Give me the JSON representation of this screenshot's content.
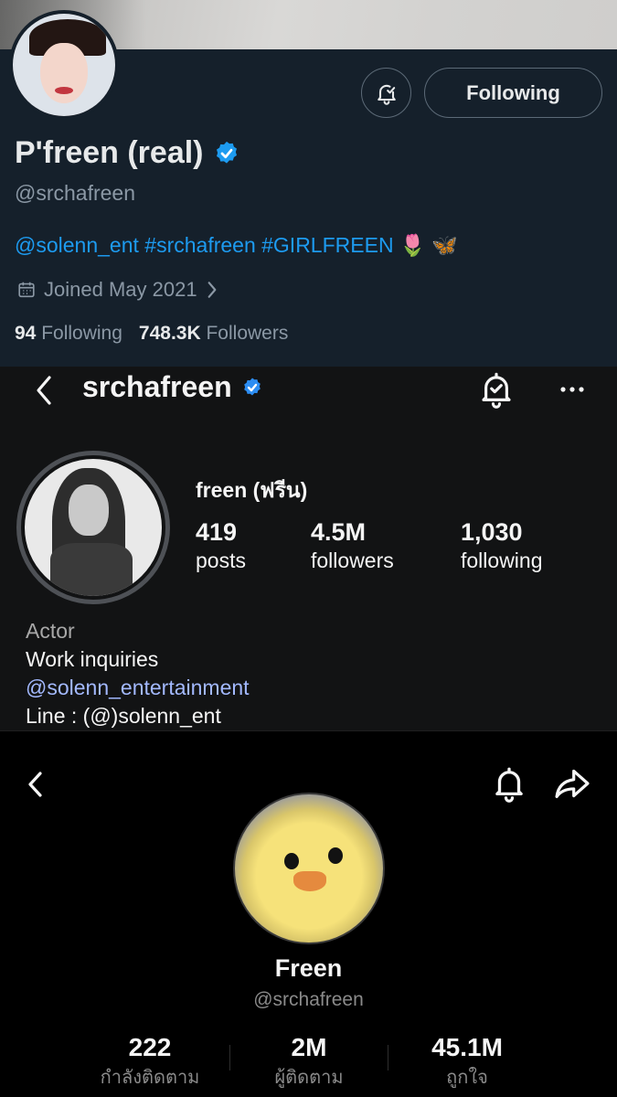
{
  "twitter": {
    "display_name": "P'freen (real)",
    "handle": "@srchafreen",
    "bio": "@solenn_ent #srchafreen #GIRLFREEN 🌷 🦋",
    "joined": "Joined May 2021",
    "following_button": "Following",
    "following_count": "94",
    "following_label": "Following",
    "followers_count": "748.3K",
    "followers_label": "Followers",
    "colors": {
      "background": "#15202b",
      "accent": "#1d9bf0",
      "muted": "#8b98a5"
    },
    "icons": [
      "calendar-icon",
      "chevron-right-icon",
      "verified-badge-icon",
      "bell-check-icon"
    ]
  },
  "instagram": {
    "username": "srchafreen",
    "full_name": "freen (ฟรีน)",
    "stats": [
      {
        "value": "419",
        "label": "posts"
      },
      {
        "value": "4.5M",
        "label": "followers"
      },
      {
        "value": "1,030",
        "label": "following"
      }
    ],
    "bio_category": "Actor",
    "bio_line1": "Work inquiries",
    "bio_link": "@solenn_entertainment",
    "bio_line3": "Line : (@)solenn_ent",
    "colors": {
      "background": "#121314",
      "link": "#a3b9ff"
    },
    "icons": [
      "back-chevron-icon",
      "verified-badge-icon",
      "bell-check-icon",
      "more-icon"
    ]
  },
  "tiktok": {
    "name": "Freen",
    "handle": "@srchafreen",
    "stats": [
      {
        "value": "222",
        "label": "กำลังติดตาม"
      },
      {
        "value": "2M",
        "label": "ผู้ติดตาม"
      },
      {
        "value": "45.1M",
        "label": "ถูกใจ"
      }
    ],
    "icons": [
      "back-chevron-icon",
      "bell-icon",
      "share-icon"
    ]
  }
}
